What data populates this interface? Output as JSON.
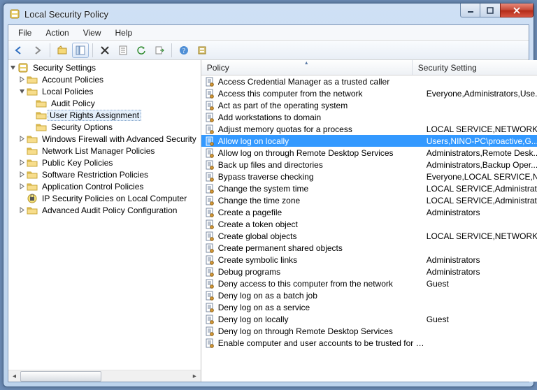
{
  "window": {
    "title": "Local Security Policy"
  },
  "menu": {
    "items": [
      "File",
      "Action",
      "View",
      "Help"
    ]
  },
  "toolbar": {
    "icons": [
      "back-icon",
      "forward-icon",
      "up-icon",
      "show-hide-tree-icon",
      "delete-icon",
      "properties-icon",
      "refresh-icon",
      "export-icon",
      "help-icon",
      "options-icon"
    ]
  },
  "tree": {
    "root": {
      "label": "Security Settings",
      "expanded": true
    },
    "nodes": [
      {
        "indent": 1,
        "label": "Account Policies",
        "icon": "folder",
        "twist": "right"
      },
      {
        "indent": 1,
        "label": "Local Policies",
        "icon": "folder",
        "twist": "down"
      },
      {
        "indent": 2,
        "label": "Audit Policy",
        "icon": "folder",
        "twist": "none"
      },
      {
        "indent": 2,
        "label": "User Rights Assignment",
        "icon": "folder",
        "twist": "none",
        "selected": true
      },
      {
        "indent": 2,
        "label": "Security Options",
        "icon": "folder",
        "twist": "none"
      },
      {
        "indent": 1,
        "label": "Windows Firewall with Advanced Security",
        "icon": "folder",
        "twist": "right"
      },
      {
        "indent": 1,
        "label": "Network List Manager Policies",
        "icon": "folder",
        "twist": "none"
      },
      {
        "indent": 1,
        "label": "Public Key Policies",
        "icon": "folder",
        "twist": "right"
      },
      {
        "indent": 1,
        "label": "Software Restriction Policies",
        "icon": "folder",
        "twist": "right"
      },
      {
        "indent": 1,
        "label": "Application Control Policies",
        "icon": "folder",
        "twist": "right"
      },
      {
        "indent": 1,
        "label": "IP Security Policies on Local Computer",
        "icon": "ipsec",
        "twist": "none"
      },
      {
        "indent": 1,
        "label": "Advanced Audit Policy Configuration",
        "icon": "folder",
        "twist": "right"
      }
    ]
  },
  "list": {
    "columns": {
      "policy": "Policy",
      "setting": "Security Setting"
    },
    "selected_index": 5,
    "rows": [
      {
        "policy": "Access Credential Manager as a trusted caller",
        "setting": ""
      },
      {
        "policy": "Access this computer from the network",
        "setting": "Everyone,Administrators,Use..."
      },
      {
        "policy": "Act as part of the operating system",
        "setting": ""
      },
      {
        "policy": "Add workstations to domain",
        "setting": ""
      },
      {
        "policy": "Adjust memory quotas for a process",
        "setting": "LOCAL SERVICE,NETWORK S..."
      },
      {
        "policy": "Allow log on locally",
        "setting": "Users,NINO-PC\\proactive,G..."
      },
      {
        "policy": "Allow log on through Remote Desktop Services",
        "setting": "Administrators,Remote Desk..."
      },
      {
        "policy": "Back up files and directories",
        "setting": "Administrators,Backup Oper..."
      },
      {
        "policy": "Bypass traverse checking",
        "setting": "Everyone,LOCAL SERVICE,N..."
      },
      {
        "policy": "Change the system time",
        "setting": "LOCAL SERVICE,Administrat..."
      },
      {
        "policy": "Change the time zone",
        "setting": "LOCAL SERVICE,Administrat..."
      },
      {
        "policy": "Create a pagefile",
        "setting": "Administrators"
      },
      {
        "policy": "Create a token object",
        "setting": ""
      },
      {
        "policy": "Create global objects",
        "setting": "LOCAL SERVICE,NETWORK S..."
      },
      {
        "policy": "Create permanent shared objects",
        "setting": ""
      },
      {
        "policy": "Create symbolic links",
        "setting": "Administrators"
      },
      {
        "policy": "Debug programs",
        "setting": "Administrators"
      },
      {
        "policy": "Deny access to this computer from the network",
        "setting": "Guest"
      },
      {
        "policy": "Deny log on as a batch job",
        "setting": ""
      },
      {
        "policy": "Deny log on as a service",
        "setting": ""
      },
      {
        "policy": "Deny log on locally",
        "setting": "Guest"
      },
      {
        "policy": "Deny log on through Remote Desktop Services",
        "setting": ""
      },
      {
        "policy": "Enable computer and user accounts to be trusted for d...",
        "setting": ""
      }
    ]
  }
}
